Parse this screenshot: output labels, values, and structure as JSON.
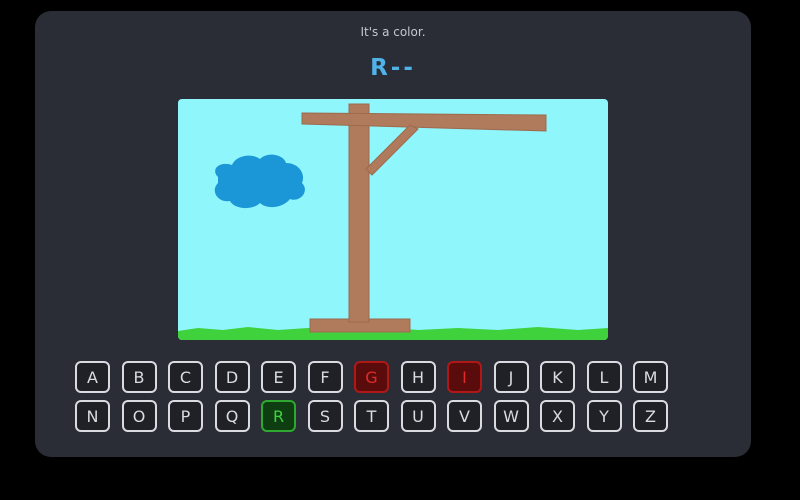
{
  "game": {
    "hint": "It's a color.",
    "word_display": "R--"
  },
  "colors": {
    "sky": "#8ff6fc",
    "grass": "#3fd23c",
    "wood": "#b07a5c",
    "cloud": "#1b97d8",
    "panel": "#2a2d35",
    "word": "#4fb3e8",
    "wrong": "#b01818",
    "correct": "#2ea82e"
  },
  "keyboard": {
    "rows": [
      [
        {
          "letter": "A",
          "state": "unused"
        },
        {
          "letter": "B",
          "state": "unused"
        },
        {
          "letter": "C",
          "state": "unused"
        },
        {
          "letter": "D",
          "state": "unused"
        },
        {
          "letter": "E",
          "state": "unused"
        },
        {
          "letter": "F",
          "state": "unused"
        },
        {
          "letter": "G",
          "state": "wrong"
        },
        {
          "letter": "H",
          "state": "unused"
        },
        {
          "letter": "I",
          "state": "wrong"
        },
        {
          "letter": "J",
          "state": "unused"
        },
        {
          "letter": "K",
          "state": "unused"
        },
        {
          "letter": "L",
          "state": "unused"
        },
        {
          "letter": "M",
          "state": "unused"
        }
      ],
      [
        {
          "letter": "N",
          "state": "unused"
        },
        {
          "letter": "O",
          "state": "unused"
        },
        {
          "letter": "P",
          "state": "unused"
        },
        {
          "letter": "Q",
          "state": "unused"
        },
        {
          "letter": "R",
          "state": "correct"
        },
        {
          "letter": "S",
          "state": "unused"
        },
        {
          "letter": "T",
          "state": "unused"
        },
        {
          "letter": "U",
          "state": "unused"
        },
        {
          "letter": "V",
          "state": "unused"
        },
        {
          "letter": "W",
          "state": "unused"
        },
        {
          "letter": "X",
          "state": "unused"
        },
        {
          "letter": "Y",
          "state": "unused"
        },
        {
          "letter": "Z",
          "state": "unused"
        }
      ]
    ]
  }
}
